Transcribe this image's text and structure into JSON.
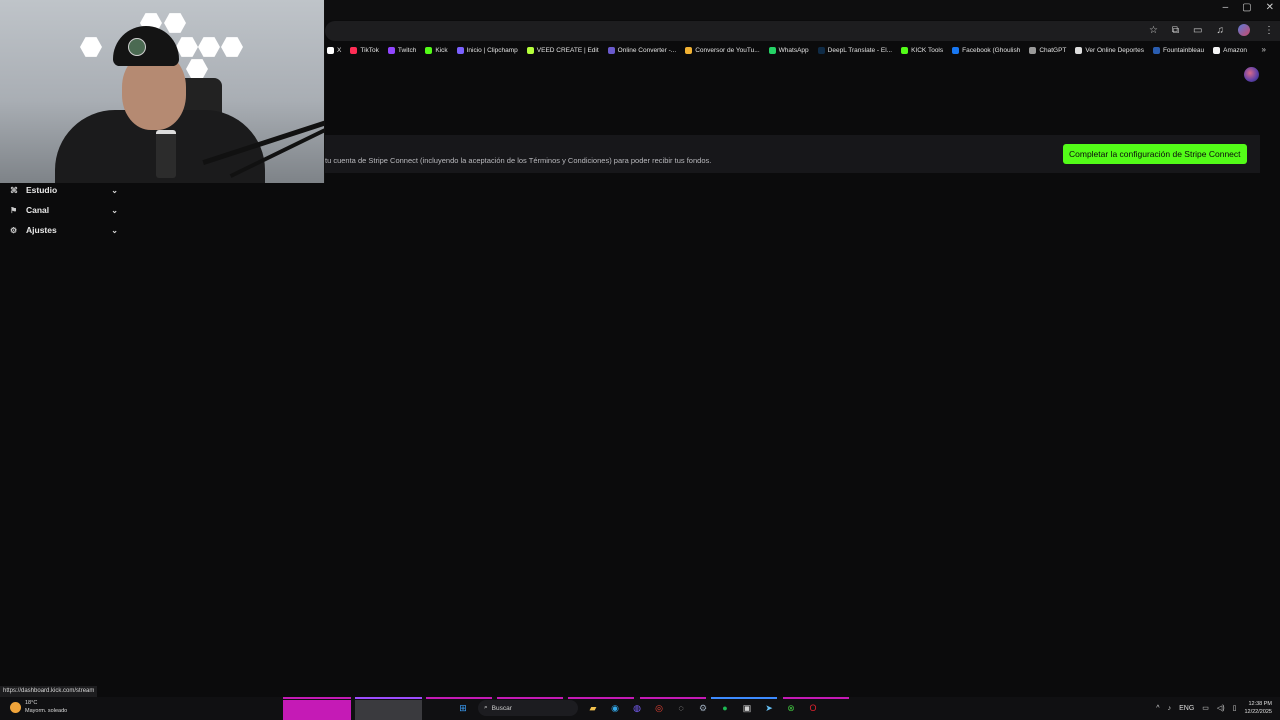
{
  "window": {
    "controls": [
      "–",
      "▢",
      "✕"
    ]
  },
  "bookmarks": [
    {
      "label": "X",
      "color": "#ffffff"
    },
    {
      "label": "TikTok",
      "color": "#ff2d55"
    },
    {
      "label": "Twitch",
      "color": "#9146ff"
    },
    {
      "label": "Kick",
      "color": "#53fc18"
    },
    {
      "label": "Inicio | Clipchamp",
      "color": "#7b61ff"
    },
    {
      "label": "VEED CREATE | Edit",
      "color": "#b5ff3b"
    },
    {
      "label": "Online Converter -...",
      "color": "#6a5acd"
    },
    {
      "label": "Conversor de YouTu...",
      "color": "#f2b233"
    },
    {
      "label": "WhatsApp",
      "color": "#25d366"
    },
    {
      "label": "DeepL Translate - El...",
      "color": "#0f2b46"
    },
    {
      "label": "KICK Tools",
      "color": "#53fc18"
    },
    {
      "label": "Facebook (Ghoulish",
      "color": "#1877f2"
    },
    {
      "label": "ChatGPT",
      "color": "#9a9a9a"
    },
    {
      "label": "Ver Online Deportes",
      "color": "#dddddd"
    },
    {
      "label": "Fountainbleau",
      "color": "#2a5db0"
    },
    {
      "label": "Amazon",
      "color": "#f5f5f5"
    }
  ],
  "banner": {
    "text": "tu cuenta de Stripe Connect (incluyendo la aceptación de los Términos y Condiciones) para poder recibir tus fondos.",
    "button_label": "Completar la configuración de Stripe Connect",
    "accent": "#53fc18"
  },
  "sidebar": {
    "items": [
      {
        "label": "Estudio",
        "icon": "studio-icon",
        "glyph": "⌘"
      },
      {
        "label": "Canal",
        "icon": "channel-icon",
        "glyph": "⚑"
      },
      {
        "label": "Ajustes",
        "icon": "settings-icon",
        "glyph": "⚙"
      }
    ]
  },
  "status_url": "https://dashboard.kick.com/stream",
  "taskbar": {
    "weather_temp": "18°C",
    "weather_desc": "Mayorm. soleado",
    "search_placeholder": "Buscar",
    "language": "ENG",
    "time": "12:38 PM",
    "date": "12/22/2025"
  }
}
